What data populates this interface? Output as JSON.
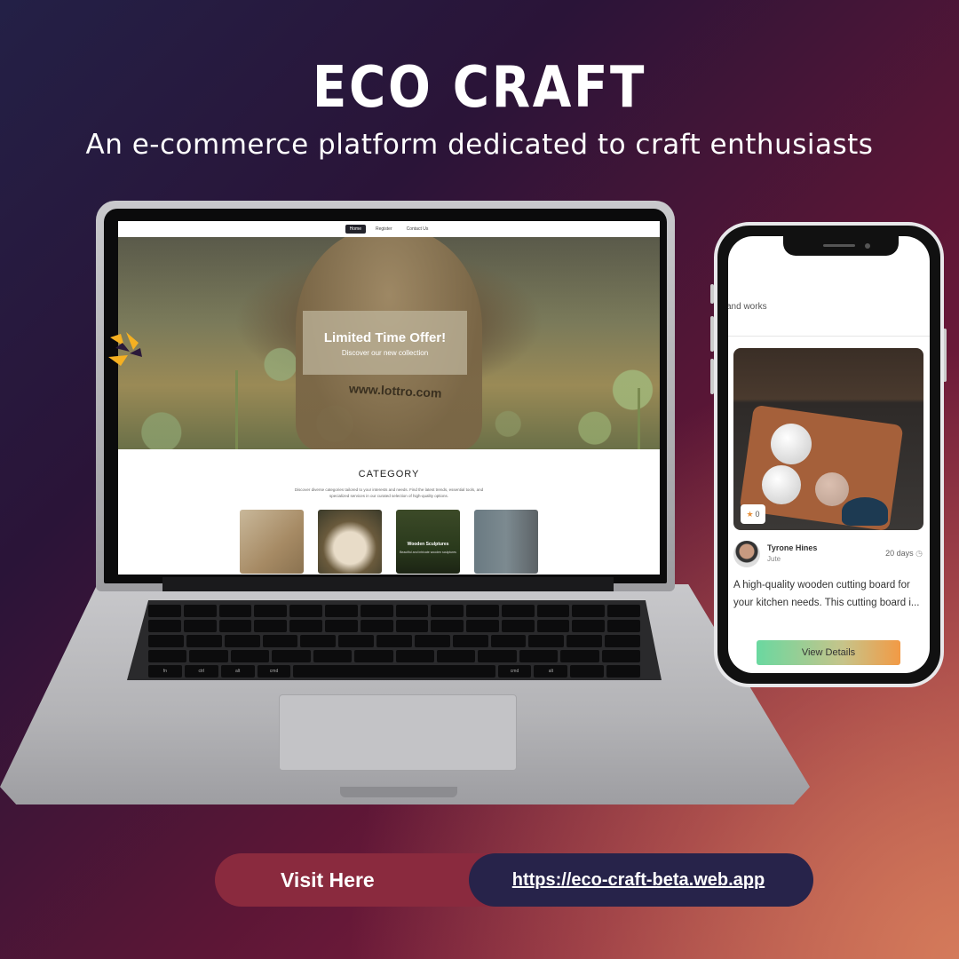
{
  "poster": {
    "title": "ECO CRAFT",
    "subtitle": "An e-commerce platform dedicated to craft enthusiasts"
  },
  "laptop_site": {
    "nav": [
      "Home",
      "Register",
      "Contact Us"
    ],
    "active_nav": "Home",
    "hero": {
      "offer_title": "Limited Time Offer!",
      "offer_subtitle": "Discover our new collection",
      "sack_text": "www.lottro.com"
    },
    "category": {
      "title": "CATEGORY",
      "description": "Discover diverse categories tailored to your interests and needs. Find the latest trends, essential tools, and specialized services in our curated selection of high-quality options.",
      "cards": [
        {
          "label": "",
          "desc": ""
        },
        {
          "label": "",
          "desc": ""
        },
        {
          "label": "Wooden Sculptures",
          "desc": "Beautiful and intricate wooden sculptures"
        },
        {
          "label": "",
          "desc": ""
        }
      ]
    }
  },
  "keyboard_keys": [
    "fn",
    "ctrl",
    "alt",
    "cmd",
    "cmd",
    "alt"
  ],
  "phone_app": {
    "top_text": "and works",
    "product": {
      "rating": "0",
      "author": "Tyrone Hines",
      "material": "Jute",
      "posted": "20 days",
      "description": "A high-quality wooden cutting board for your kitchen needs. This cutting board i...",
      "button": "View Details"
    }
  },
  "cta": {
    "label": "Visit Here",
    "url": "https://eco-craft-beta.web.app"
  },
  "colors": {
    "accent_star": "#e8913c",
    "cta_left": "#8a2a3e",
    "cta_right": "#27234a",
    "logo_yellow": "#f5b021"
  }
}
